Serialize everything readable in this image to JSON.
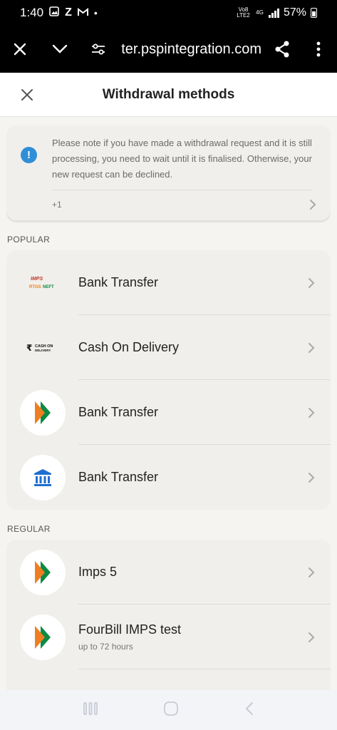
{
  "status_bar": {
    "time": "1:40",
    "volte_label": "Vo8 LTE2",
    "network_label": "4G",
    "battery": "57%"
  },
  "browser": {
    "url": "ter.pspintegration.com"
  },
  "header": {
    "title": "Withdrawal methods"
  },
  "notice": {
    "text": "Please note if you have made a withdrawal request and it is still processing, you need to wait until it is finalised. Otherwise, your new request can be declined.",
    "more_label": "+1"
  },
  "sections": {
    "popular": {
      "label": "POPULAR",
      "items": [
        {
          "title": "Bank Transfer",
          "logo": "imps-neft-logo"
        },
        {
          "title": "Cash On Delivery",
          "logo": "cash-on-delivery-logo"
        },
        {
          "title": "Bank Transfer",
          "logo": "upi-logo"
        },
        {
          "title": "Bank Transfer",
          "logo": "bank-building-icon"
        }
      ]
    },
    "regular": {
      "label": "REGULAR",
      "items": [
        {
          "title": "Imps 5",
          "logo": "upi-logo"
        },
        {
          "title": "FourBill IMPS test",
          "subtitle": "up to 72 hours",
          "logo": "upi-logo"
        }
      ]
    }
  },
  "logo_text": {
    "imps": "IMPS",
    "neft": "NEFT",
    "rtgs": "RTGS",
    "cod_top": "CASH ON",
    "cod_bottom": "DELIVERY",
    "rupee": "₹"
  },
  "colors": {
    "accent_blue": "#2f8ed6",
    "upi_orange": "#ef7d22",
    "upi_green": "#0b8a43"
  }
}
